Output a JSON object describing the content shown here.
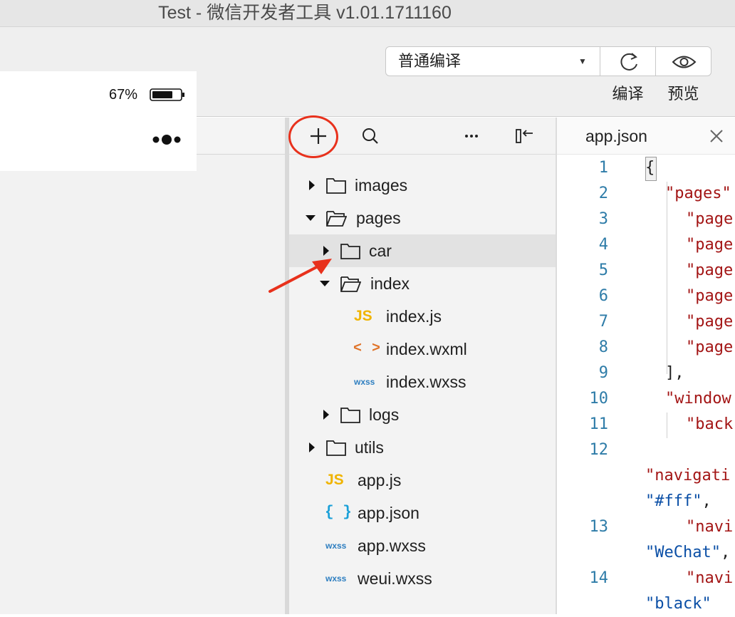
{
  "window": {
    "title": "Test - 微信开发者工具 v1.01.1711160"
  },
  "toolbar": {
    "compile_mode": "普通编译",
    "compile_label": "编译",
    "preview_label": "预览"
  },
  "simulator": {
    "battery_percent": "67%"
  },
  "file_tree": {
    "items": [
      {
        "label": "images",
        "type": "folder",
        "expanded": false
      },
      {
        "label": "pages",
        "type": "folder",
        "expanded": true
      },
      {
        "label": "car",
        "type": "folder",
        "expanded": false,
        "selected": true
      },
      {
        "label": "index",
        "type": "folder",
        "expanded": true
      },
      {
        "label": "index.js",
        "type": "js"
      },
      {
        "label": "index.wxml",
        "type": "wxml"
      },
      {
        "label": "index.wxss",
        "type": "wxss"
      },
      {
        "label": "logs",
        "type": "folder",
        "expanded": false
      },
      {
        "label": "utils",
        "type": "folder",
        "expanded": false
      },
      {
        "label": "app.js",
        "type": "js"
      },
      {
        "label": "app.json",
        "type": "json"
      },
      {
        "label": "app.wxss",
        "type": "wxss"
      },
      {
        "label": "weui.wxss",
        "type": "wxss"
      }
    ],
    "icon_text": {
      "js": "JS",
      "xml": "< >",
      "wxss": "wxss",
      "json": "{ }"
    }
  },
  "editor": {
    "tab_label": "app.json",
    "line_numbers": [
      "1",
      "2",
      "3",
      "4",
      "5",
      "6",
      "7",
      "8",
      "9",
      "10",
      "11",
      "12",
      "13",
      "14"
    ],
    "code": {
      "l1": "{",
      "l2": "\"pages\"",
      "l3": "\"page",
      "l4": "\"page",
      "l5": "\"page",
      "l6": "\"page",
      "l7": "\"page",
      "l8": "\"page",
      "l9": "],",
      "l10": "\"window",
      "l11": "\"back",
      "l12a": "\"navigati",
      "l12b": "\"#fff\"",
      "l12b_punct": ",",
      "l13a": "\"navi",
      "l13b": "\"WeChat\"",
      "l13b_punct": ",",
      "l14a": "\"navi",
      "l14b": "\"black\""
    }
  },
  "colors": {
    "accent_red": "#e8311c",
    "js_yellow": "#f0b400",
    "xml_orange": "#e0742a",
    "wxss_blue": "#2d7ec0",
    "json_cyan": "#1aa0d8",
    "line_number_blue": "#2e7ca8",
    "string_key_red": "#a31515",
    "string_value_blue": "#0b4fa6"
  },
  "icons": {
    "add": "plus-icon",
    "search": "search-icon",
    "more": "ellipsis-icon",
    "collapse": "collapse-panel-icon",
    "refresh": "refresh-icon",
    "preview": "eye-icon",
    "close": "close-icon"
  }
}
